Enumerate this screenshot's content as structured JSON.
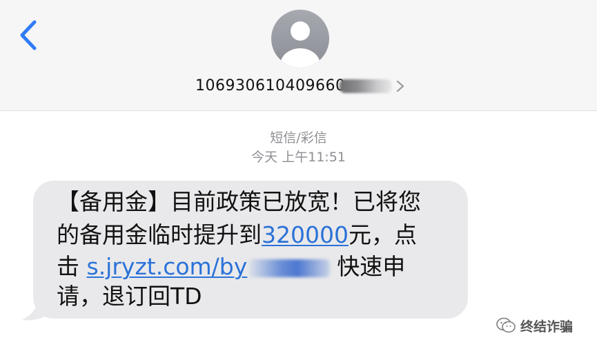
{
  "header": {
    "back_icon": "chevron-left-icon",
    "avatar_icon": "person-silhouette-icon",
    "contact_number": "10693061040966",
    "contact_suffix_visible": "0",
    "contact_chevron_icon": "chevron-right-icon"
  },
  "thread": {
    "message_type": "短信/彩信",
    "timestamp": "今天 上午11:51"
  },
  "message": {
    "line1": "【备用金】目前政策已放宽！已将您",
    "line2_prefix": "的备用金临时提升到",
    "line2_amount": "320000",
    "line2_suffix": "元，点",
    "line3_prefix": "击 ",
    "line3_link": "s.jryzt.com/by",
    "line3_suffix": "快速申",
    "line4": "请，退订回TD"
  },
  "watermark": {
    "icon": "wechat-icon",
    "text": "终结诈骗"
  },
  "colors": {
    "header_bg": "#f6f6f7",
    "bubble_bg": "#e9e9eb",
    "link": "#2a72d8",
    "ios_blue": "#2f7cf6",
    "meta_gray": "#8e8e93"
  }
}
